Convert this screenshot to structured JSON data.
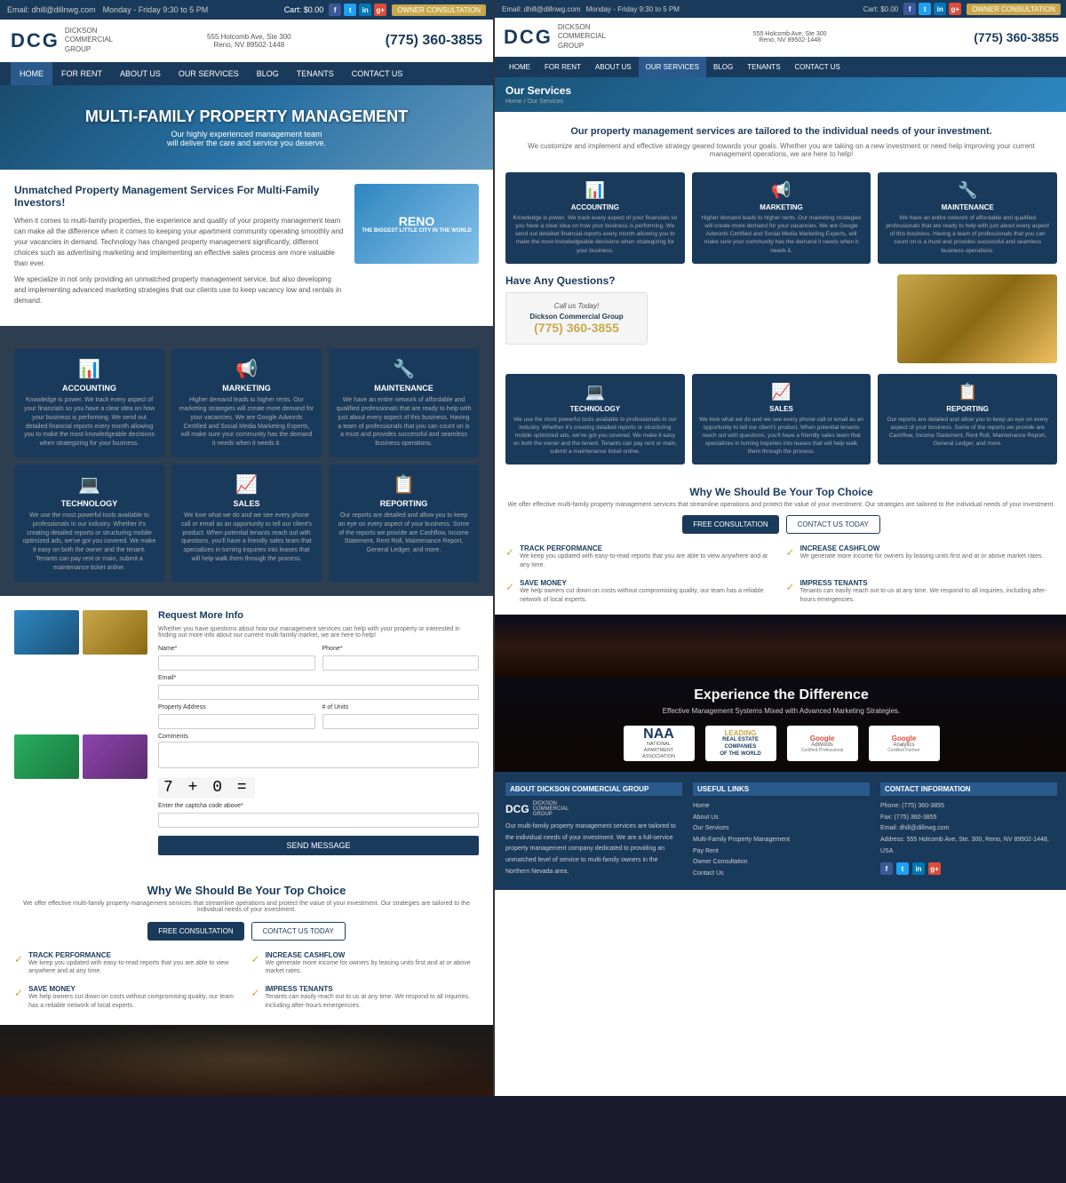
{
  "site": {
    "name": "DCG",
    "full_name": "Dickson Commercial Group",
    "phone": "(775) 360-3855",
    "email": "Email: dhill@dillnwg.com",
    "hours": "Monday - Friday 9:30 to 5 PM",
    "address_line1": "555 Holcomb Ave, Ste 300",
    "address_line2": "Reno, NV 89502-1448",
    "cart": "Cart: $0.00"
  },
  "nav": {
    "items": [
      "HOME",
      "FOR RENT",
      "ABOUT US",
      "OUR SERVICES",
      "BLOG",
      "TENANTS",
      "CONTACT US"
    ]
  },
  "hero": {
    "title": "MULTI-FAMILY PROPERTY MANAGEMENT",
    "subtitle": "Our highly experienced management team\nwill deliver the care and service you deserve."
  },
  "left": {
    "intro_title": "Unmatched Property Management Services For Multi-Family Investors!",
    "intro_text1": "When it comes to multi-family properties, the experience and quality of your property management team can make all the difference when it comes to keeping your apartment community operating smoothly and your vacancies in demand. Technology has changed property management significantly, different choices such as advertising marketing and implementing an effective sales process are more valuable than ever.",
    "intro_text2": "We specialize in not only providing an unmatched property management service, but also developing and implementing advanced marketing strategies that our clients use to keep vacancy low and rentals in demand.",
    "reno_label": "RENO",
    "services_section": {
      "cards": [
        {
          "icon": "📊",
          "title": "ACCOUNTING",
          "desc": "Knowledge is power. We track every aspect of your financials so you have a clear idea on how your business is performing. We send out detailed financial reports every month allowing you to make the most knowledgeable decisions when strategizing for your business."
        },
        {
          "icon": "📢",
          "title": "MARKETING",
          "desc": "Higher demand leads to higher rents. Our marketing strategies will create more demand for your vacancies. Not We are Google Adwords Certified and Social Media Marketing Experts, will make sure your community has the demand it needs when it needs it."
        },
        {
          "icon": "🔧",
          "title": "MAINTENANCE",
          "desc": "We have an entire network of affordable and qualified professionals that are ready to help with just about every aspect of this business. Having a team of professionals that you can count on is a must and provides successful and seamless business operations."
        },
        {
          "icon": "💻",
          "title": "TECHNOLOGY",
          "desc": "We use the most powerful tools available to professionals in our industry. Whether it's creating detailed reports or structuring mobile optimized ads, we've got you covered. We make it easy on both the owner and the tenant. Tenants can pay rent or main, submit a maintenance ticket online."
        },
        {
          "icon": "📈",
          "title": "SALES",
          "desc": "We love what we do and we see every phone call or email as an opportunity to tell our client's product. When potential tenants reach out with questions, you'll have a friendly sales team that specializes in turning inquiries into leases that will help walk them through the process."
        },
        {
          "icon": "📋",
          "title": "REPORTING",
          "desc": "Our reports are detailed and allow you to keep an eye on every aspect of your business. Some of the reports we provide are Cashflow, Income Statement, Rent Roll, Maintenance Report, General Ledger, and more."
        }
      ]
    },
    "request_section": {
      "title": "Request More Info",
      "desc": "Whether you have questions about how our management services can help with your property or interested in finding out more info about our current multi-family market, we are here to help!",
      "fields": {
        "name": "Name*",
        "phone": "Phone*",
        "email": "Email*",
        "property_address": "Property Address",
        "units": "# of Units",
        "comments": "Comments",
        "captcha": "Enter the captcha code above*"
      },
      "submit": "SEND MESSAGE"
    },
    "why_section": {
      "title": "Why We Should Be Your Top Choice",
      "desc": "We offer effective multi-family property management services that streamline operations and protect the value of your investment. Our strategies are tailored to the individual needs of your investment.",
      "btn_consultation": "FREE CONSULTATION",
      "btn_contact": "CONTACT US TODAY",
      "features": [
        {
          "title": "Track PERFORMANCE",
          "desc": "We keep you updated with easy-to-read reports that you are able to view anywhere and at any time."
        },
        {
          "title": "Increase CASHFLOW",
          "desc": "We generate more income for owners by leasing units first and at or above market rates."
        },
        {
          "title": "Save MONEY",
          "desc": "We help owners cut down on costs without compromising quality, our team has a reliable network of local experts."
        },
        {
          "title": "Impress TENANTS",
          "desc": "Tenants can easily reach out to us at any time. We respond to all inquiries, including after-hours emergencies."
        }
      ]
    }
  },
  "right": {
    "services_banner": {
      "title": "Our Services",
      "breadcrumb": "Home / Our Services"
    },
    "intro": {
      "title": "Our property management services are tailored to the individual needs of your investment.",
      "desc": "We customize and implement and effective strategy geared towards your goals. Whether you are taking on a new investment or need help improving your current management operations, we are here to help!"
    },
    "service_cards": [
      {
        "icon": "📊",
        "title": "ACCOUNTING",
        "desc": "Knowledge is power. We track every aspect of your financials so you have a clear idea on how your business is performing. We send out detailed financial reports every month allowing you to make the most knowledgeable decisions when strategizing for your business."
      },
      {
        "icon": "📢",
        "title": "MARKETING",
        "desc": "Higher demand leads to higher rents. Our marketing strategies will create more demand for your vacancies. Not We are Google Adwords Certified and Social Media Marketing Experts, will make sure your community has the demand it needs when it needs it."
      },
      {
        "icon": "🔧",
        "title": "MAINTENANCE",
        "desc": "We have an entire network of affordable and qualified professionals that are ready to help with just about every aspect of this business. Having a team of professionals that you can count on is a must and provides successful and seamless business operations."
      }
    ],
    "service_cards2": [
      {
        "icon": "💻",
        "title": "TECHNOLOGY",
        "desc": "We use the most powerful tools available to professionals in our industry. Whether it's creating detailed reports or structuring mobile optimized ads, we've got you covered. We make it easy on both the owner and the tenant. Tenants can pay rent or main, submit a maintenance ticket online."
      },
      {
        "icon": "📈",
        "title": "SALES",
        "desc": "We love what we do and we see every phone call or email as an opportunity to tell our client's product. When potential tenants reach out with questions, you'll have a friendly sales team that specializes in turning inquiries into leases that will help walk them through the process."
      },
      {
        "icon": "📋",
        "title": "REPORTING",
        "desc": "Our reports are detailed and allow you to keep an eye on every aspect of your business. Some of the reports we provide are Cashflow, Income Statement, Rent Roll, Maintenance Report, General Ledger, and more."
      }
    ],
    "questions": {
      "title": "Have Any Questions?",
      "call_label": "Call us Today!",
      "company": "Dickson Commercial Group",
      "phone": "(775) 360-3855"
    },
    "why": {
      "title": "Why We Should Be Your Top Choice",
      "desc": "We offer effective multi-family property management services that streamline operations and protect the value of your investment. Our strategies are tailored to the individual needs of your investment.",
      "btn1": "FREE CONSULTATION",
      "btn2": "CONTACT US TODAY",
      "features": [
        {
          "title": "Track PERFORMANCE",
          "desc": "We keep you updated with easy-to-read reports that you are able to view anywhere and at any time."
        },
        {
          "title": "Increase CASHFLOW",
          "desc": "We generate more income for owners by leasing units first and at or above market rates."
        },
        {
          "title": "Save MONEY",
          "desc": "We help owners cut down on costs without compromising quality, our team has a reliable network of local experts."
        },
        {
          "title": "Impress TENANTS",
          "desc": "Tenants can easily reach out to us at any time. We respond to all inquiries, including after-hours emergencies."
        }
      ]
    },
    "experience": {
      "title": "Experience the Difference",
      "subtitle": "Effective Management Systems Mixed with Advanced Marketing Strategies.",
      "logos": [
        {
          "name": "NAA",
          "full": "National Apartment Association",
          "sub": ""
        },
        {
          "name": "Leading",
          "full": "Leading\nREAL ESTATE\nCOMPANIES\nOF THE WORLD",
          "sub": ""
        },
        {
          "name": "Google AdWords",
          "full": "Google AdWords",
          "sub": "Certified Professional"
        },
        {
          "name": "Google Analytics",
          "full": "Google Analytics",
          "sub": "Certified Partner"
        }
      ]
    },
    "footer": {
      "cols": [
        {
          "title": "ABOUT DICKSON COMMERCIAL GROUP",
          "content": "Our multi-family property management services are tailored to the individual needs of your investment. We are a full-service property management company dedicated to providing an unmatched level of service to multi-family owners in the Northern Nevada area."
        },
        {
          "title": "USEFUL LINKS",
          "links": [
            "Home",
            "About Us",
            "Our Services",
            "Multi-Family Property Management",
            "Pay Rent",
            "Owner Consultation",
            "Contact Us"
          ]
        },
        {
          "title": "CONTACT INFORMATION",
          "phone": "Phone: (775) 360-3855",
          "fax": "Fax: (775) 360-3855",
          "email": "Email: dhill@dillnwg.com",
          "address": "Address: 555 Holcomb Ave, Ste. 300, Reno, NV 89502-1448, USA"
        }
      ]
    }
  }
}
